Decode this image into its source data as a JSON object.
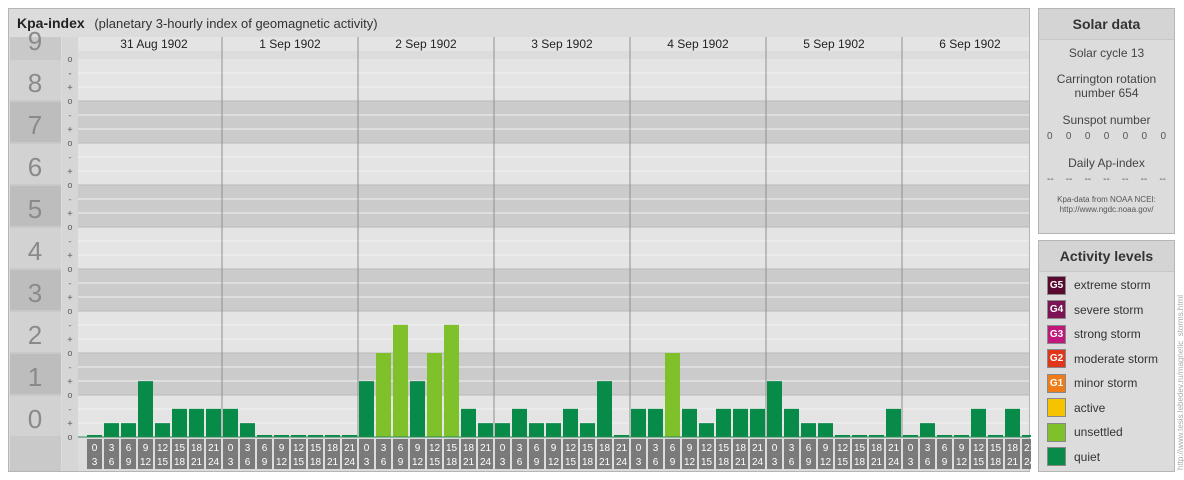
{
  "header": {
    "title": "Kpa-index",
    "subtitle": "(planetary 3-hourly index of geomagnetic activity)"
  },
  "chart_data": {
    "type": "bar",
    "title": "Kpa-index",
    "subtitle": "(planetary 3-hourly index of geomagnetic activity)",
    "ylim": [
      0,
      9
    ],
    "y_ticks": [
      "0",
      "1",
      "2",
      "3",
      "4",
      "5",
      "6",
      "7",
      "8",
      "9"
    ],
    "sub_ticks": [
      "o",
      "-",
      "+"
    ],
    "days": [
      "31 Aug 1902",
      "1 Sep 1902",
      "2 Sep 1902",
      "3 Sep 1902",
      "4 Sep 1902",
      "5 Sep 1902",
      "6 Sep 1902"
    ],
    "interval_start": [
      "0",
      "3",
      "6",
      "9",
      "12",
      "15",
      "18",
      "21"
    ],
    "interval_end": [
      "3",
      "6",
      "9",
      "12",
      "15",
      "18",
      "21",
      "24"
    ],
    "values": [
      [
        0.0,
        0.33,
        0.33,
        1.33,
        0.33,
        0.67,
        0.67,
        0.67
      ],
      [
        0.67,
        0.33,
        0.0,
        0.0,
        0.0,
        0.0,
        0.0,
        0.0
      ],
      [
        1.33,
        2.0,
        2.67,
        1.33,
        2.0,
        2.67,
        0.67,
        0.33
      ],
      [
        0.33,
        0.67,
        0.33,
        0.33,
        0.67,
        0.33,
        1.33,
        0.0
      ],
      [
        0.67,
        0.67,
        2.0,
        0.67,
        0.33,
        0.67,
        0.67,
        0.67
      ],
      [
        1.33,
        0.67,
        0.33,
        0.33,
        0.0,
        0.0,
        0.0,
        0.67
      ],
      [
        0.0,
        0.33,
        0.0,
        0.0,
        0.67,
        0.0,
        0.67,
        0.0
      ]
    ],
    "thresholds": {
      "unsettled": 2,
      "active": 4,
      "G1": 5,
      "G2": 6,
      "G3": 7,
      "G4": 8,
      "G5": 9
    }
  },
  "solar": {
    "title": "Solar data",
    "cycle": "Solar cycle 13",
    "carrington_line1": "Carrington rotation",
    "carrington_line2": "number 654",
    "sunspot_label": "Sunspot number",
    "sunspot_values": [
      "0",
      "0",
      "0",
      "0",
      "0",
      "0",
      "0"
    ],
    "ap_label": "Daily Ap-index",
    "ap_values": [
      "--",
      "--",
      "--",
      "--",
      "--",
      "--",
      "--"
    ],
    "credit_line1": "Kpa-data from NOAA NCEI:",
    "credit_line2": "http://www.ngdc.noaa.gov/"
  },
  "activity": {
    "title": "Activity levels",
    "items": [
      {
        "badge": "G5",
        "label": "extreme storm",
        "color": "#5a0a2e"
      },
      {
        "badge": "G4",
        "label": "severe storm",
        "color": "#7b1354"
      },
      {
        "badge": "G3",
        "label": "strong storm",
        "color": "#c0187a"
      },
      {
        "badge": "G2",
        "label": "moderate storm",
        "color": "#e0371b"
      },
      {
        "badge": "G1",
        "label": "minor storm",
        "color": "#f07c17"
      },
      {
        "badge": "",
        "label": "active",
        "color": "#f6c300"
      },
      {
        "badge": "",
        "label": "unsettled",
        "color": "#7fc12a"
      },
      {
        "badge": "",
        "label": "quiet",
        "color": "#088a49"
      }
    ]
  },
  "side_credit": "http://www.tesis.lebedev.ru/magnetic_storms.html"
}
